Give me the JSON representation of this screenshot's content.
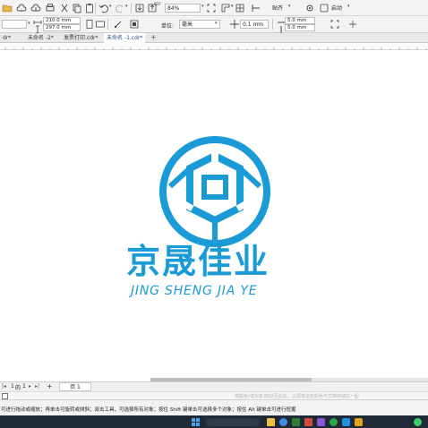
{
  "toolbar": {
    "zoom_value": "84%",
    "paste_label": "贴齐",
    "launch_label": "启动"
  },
  "property_bar": {
    "width_value": "210.0 mm",
    "height_value": "297.0 mm",
    "units_label": "单位:",
    "units_value": "毫米",
    "nudge_value": "0.1 mm",
    "dup_x_value": "5.0 mm",
    "dup_y_value": "5.0 mm"
  },
  "tabs": [
    {
      "label": "dr*"
    },
    {
      "label": "未命名 -2*"
    },
    {
      "label": "发票打印.cdr*"
    },
    {
      "label": "未命名 -1.cdr*"
    }
  ],
  "logo": {
    "chinese": "京晟佳业",
    "pinyin": "JING SHENG JIA YE",
    "color": "#1a9ad6"
  },
  "page_nav": {
    "current": "1",
    "of_label": "的",
    "total": "1",
    "tab_label": "页 1"
  },
  "colorbar_hint": "将颜色(或对象)拖动至此处，以便将这些颜色与文档存储在一起",
  "status_text": "可进行拖动或缩放；再单击可旋转或倾斜；双击工具，可选择所有对象；按住 Shift 键单击可选择多个对象；按住 Alt 键单击可进行挖掘",
  "colors": {
    "brand_blue": "#1a9ad6",
    "toolbar_bg": "#f3f3f3",
    "taskbar_bg": "#1f2a36"
  }
}
